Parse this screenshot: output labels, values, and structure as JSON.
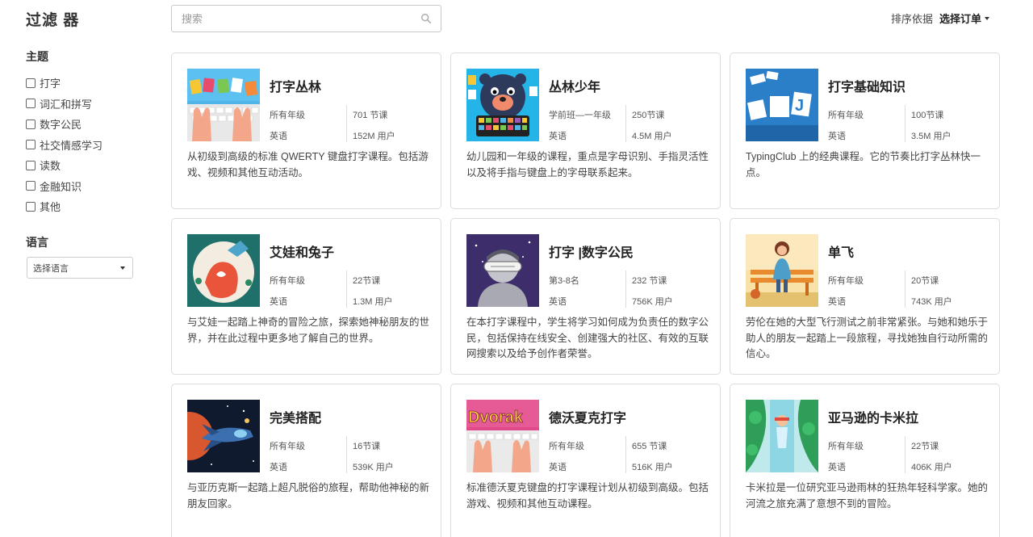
{
  "sidebar": {
    "filter_title": "过滤 器",
    "topic_title": "主题",
    "topics": [
      "打字",
      "词汇和拼写",
      "数字公民",
      "社交情感学习",
      "读数",
      "金融知识",
      "其他"
    ],
    "language_title": "语言",
    "language_select": "选择语言"
  },
  "search": {
    "placeholder": "搜索",
    "value": ""
  },
  "sort": {
    "label": "排序依据",
    "value": "选择订单"
  },
  "courses": [
    {
      "title": "打字丛林",
      "grade": "所有年级",
      "lessons": "701 节课",
      "language": "英语",
      "users": "152M 用户",
      "description": "从初级到高级的标准 QWERTY 键盘打字课程。包括游戏、视频和其他互动活动。",
      "icon": "typing-jungle-thumbnail"
    },
    {
      "title": "丛林少年",
      "grade": "学前班—一年级",
      "lessons": "250节课",
      "language": "英语",
      "users": "4.5M 用户",
      "description": "幼儿园和一年级的课程，重点是字母识别、手指灵活性以及将手指与键盘上的字母联系起来。",
      "icon": "jungle-junior-thumbnail"
    },
    {
      "title": "打字基础知识",
      "grade": "所有年级",
      "lessons": "100节课",
      "language": "英语",
      "users": "3.5M 用户",
      "description": "TypingClub 上的经典课程。它的节奏比打字丛林快一点。",
      "icon": "typing-basics-thumbnail"
    },
    {
      "title": "艾娃和兔子",
      "grade": "所有年级",
      "lessons": "22节课",
      "language": "英语",
      "users": "1.3M 用户",
      "description": "与艾娃一起踏上神奇的冒险之旅，探索她神秘朋友的世界，并在此过程中更多地了解自己的世界。",
      "icon": "ava-rabbit-thumbnail"
    },
    {
      "title": "打字 |数字公民",
      "grade": "第3-8名",
      "lessons": "232 节课",
      "language": "英语",
      "users": "756K 用户",
      "description": "在本打字课程中，学生将学习如何成为负责任的数字公民，包括保持在线安全、创建强大的社区、有效的互联网搜索以及给予创作者荣誉。",
      "icon": "digital-citizenship-thumbnail"
    },
    {
      "title": "单飞",
      "grade": "所有年级",
      "lessons": "20节课",
      "language": "英语",
      "users": "743K 用户",
      "description": "劳伦在她的大型飞行测试之前非常紧张。与她和她乐于助人的朋友一起踏上一段旅程，寻找她独自行动所需的信心。",
      "icon": "solo-flight-thumbnail"
    },
    {
      "title": "完美搭配",
      "grade": "所有年级",
      "lessons": "16节课",
      "language": "英语",
      "users": "539K 用户",
      "description": "与亚历克斯一起踏上超凡脱俗的旅程，帮助他神秘的新朋友回家。",
      "icon": "perfect-match-thumbnail"
    },
    {
      "title": "德沃夏克打字",
      "grade": "所有年级",
      "lessons": "655 节课",
      "language": "英语",
      "users": "516K 用户",
      "description": "标准德沃夏克键盘的打字课程计划从初级到高级。包括游戏、视频和其他互动课程。",
      "icon": "dvorak-thumbnail"
    },
    {
      "title": "亚马逊的卡米拉",
      "grade": "所有年级",
      "lessons": "22节课",
      "language": "英语",
      "users": "406K 用户",
      "description": "卡米拉是一位研究亚马逊雨林的狂热年轻科学家。她的河流之旅充满了意想不到的冒险。",
      "icon": "camila-amazon-thumbnail"
    }
  ]
}
